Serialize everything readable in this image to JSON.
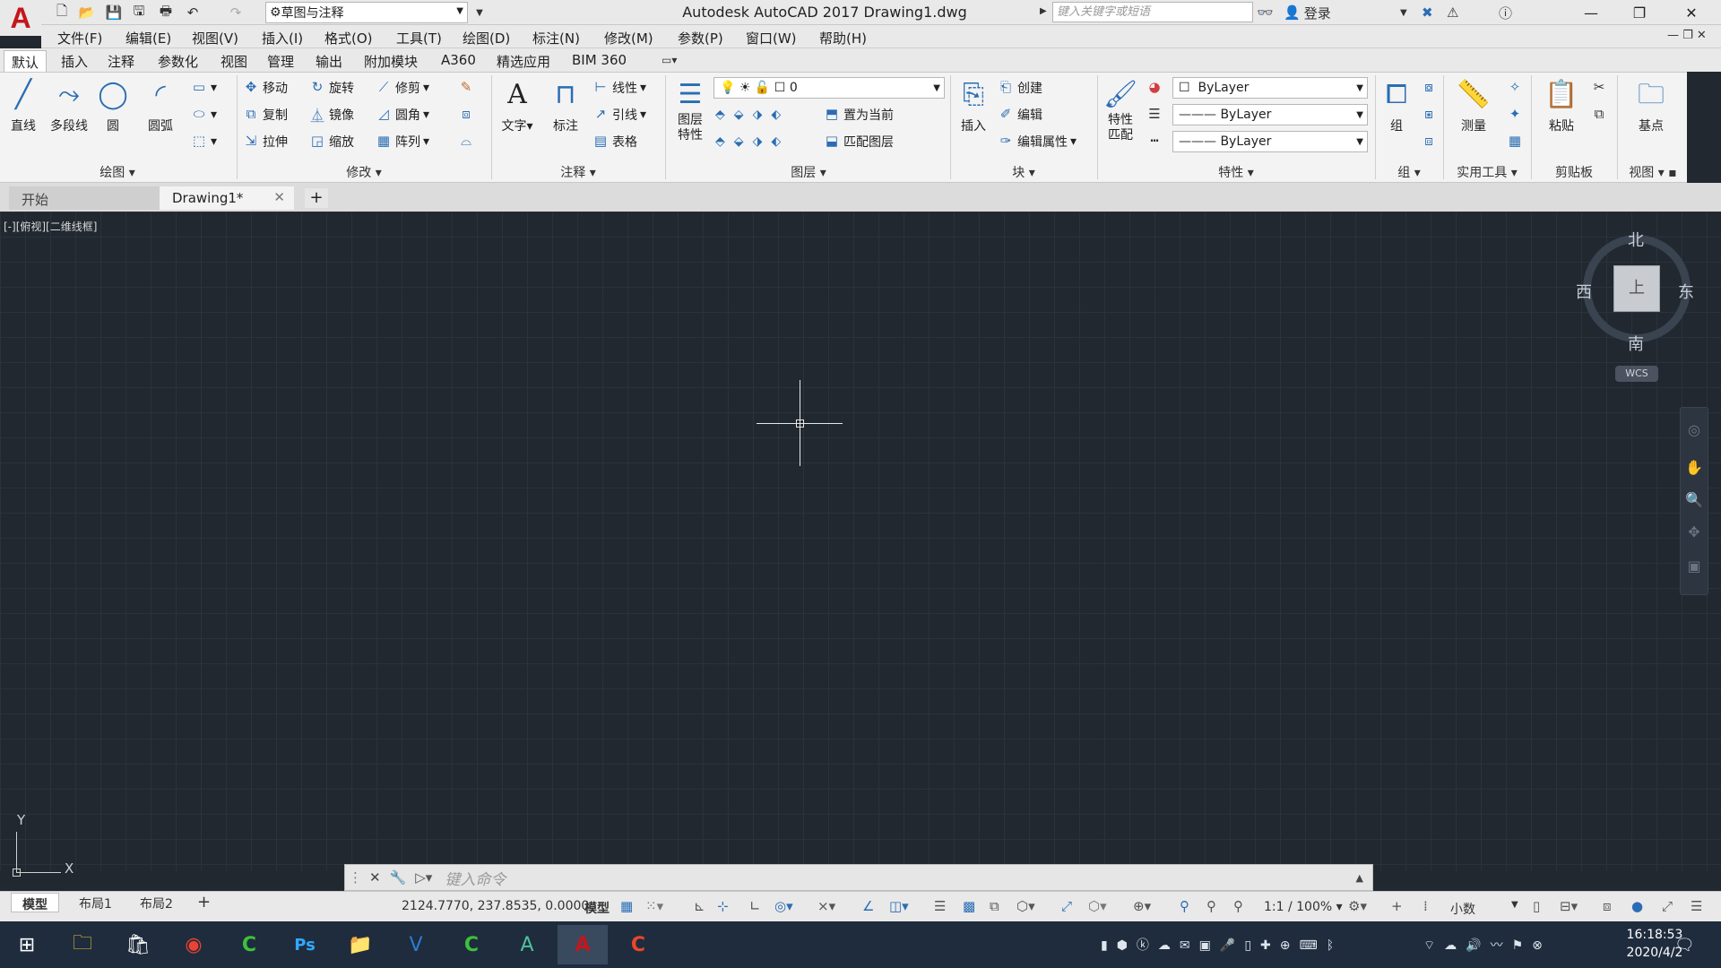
{
  "titlebar": {
    "workspace": "草图与注释",
    "title": "Autodesk AutoCAD 2017    Drawing1.dwg",
    "search_placeholder": "键入关键字或短语",
    "login": "登录"
  },
  "menubar": [
    "文件(F)",
    "编辑(E)",
    "视图(V)",
    "插入(I)",
    "格式(O)",
    "工具(T)",
    "绘图(D)",
    "标注(N)",
    "修改(M)",
    "参数(P)",
    "窗口(W)",
    "帮助(H)"
  ],
  "ribbon_tabs": [
    "默认",
    "插入",
    "注释",
    "参数化",
    "视图",
    "管理",
    "输出",
    "附加模块",
    "A360",
    "精选应用",
    "BIM 360"
  ],
  "ribbon": {
    "draw": {
      "title": "绘图",
      "line": "直线",
      "polyline": "多段线",
      "circle": "圆",
      "arc": "圆弧"
    },
    "modify": {
      "title": "修改",
      "move": "移动",
      "rotate": "旋转",
      "trim": "修剪",
      "copy": "复制",
      "mirror": "镜像",
      "fillet": "圆角",
      "stretch": "拉伸",
      "scale": "缩放",
      "array": "阵列"
    },
    "annotation": {
      "title": "注释",
      "text": "文字",
      "dimension": "标注",
      "linear": "线性",
      "leader": "引线",
      "table": "表格"
    },
    "layers": {
      "title": "图层",
      "layer_props": "图层\n特性",
      "current_layer": "0",
      "set_current": "置为当前",
      "match_layer": "匹配图层"
    },
    "block": {
      "title": "块",
      "insert": "插入",
      "create": "创建",
      "edit": "编辑",
      "edit_attr": "编辑属性"
    },
    "properties": {
      "title": "特性",
      "match": "特性\n匹配",
      "color": "ByLayer",
      "linetype": "ByLayer",
      "lineweight": "ByLayer"
    },
    "groups": {
      "title": "组",
      "group": "组"
    },
    "utilities": {
      "title": "实用工具",
      "measure": "测量"
    },
    "clipboard": {
      "title": "剪贴板",
      "paste": "粘贴"
    },
    "view": {
      "title": "视图",
      "base": "基点"
    }
  },
  "doc_tabs": {
    "start": "开始",
    "drawing": "Drawing1*"
  },
  "viewport": {
    "label": "[-][俯视][二维线框]",
    "compass": {
      "n": "北",
      "s": "南",
      "e": "东",
      "w": "西",
      "top": "上"
    },
    "wcs": "WCS"
  },
  "ucs": {
    "x": "X",
    "y": "Y"
  },
  "command": {
    "placeholder": "键入命令"
  },
  "layout_tabs": [
    "模型",
    "布局1",
    "布局2"
  ],
  "status": {
    "coords": "2124.7770, 237.8535, 0.0000",
    "model": "模型",
    "scale": "1:1 / 100%",
    "units": "小数"
  },
  "clock": {
    "time": "16:18:53",
    "date": "2020/4/2"
  },
  "colors": {
    "brand": "#c4161c",
    "accent": "#2a6db4",
    "canvas": "#212830"
  }
}
